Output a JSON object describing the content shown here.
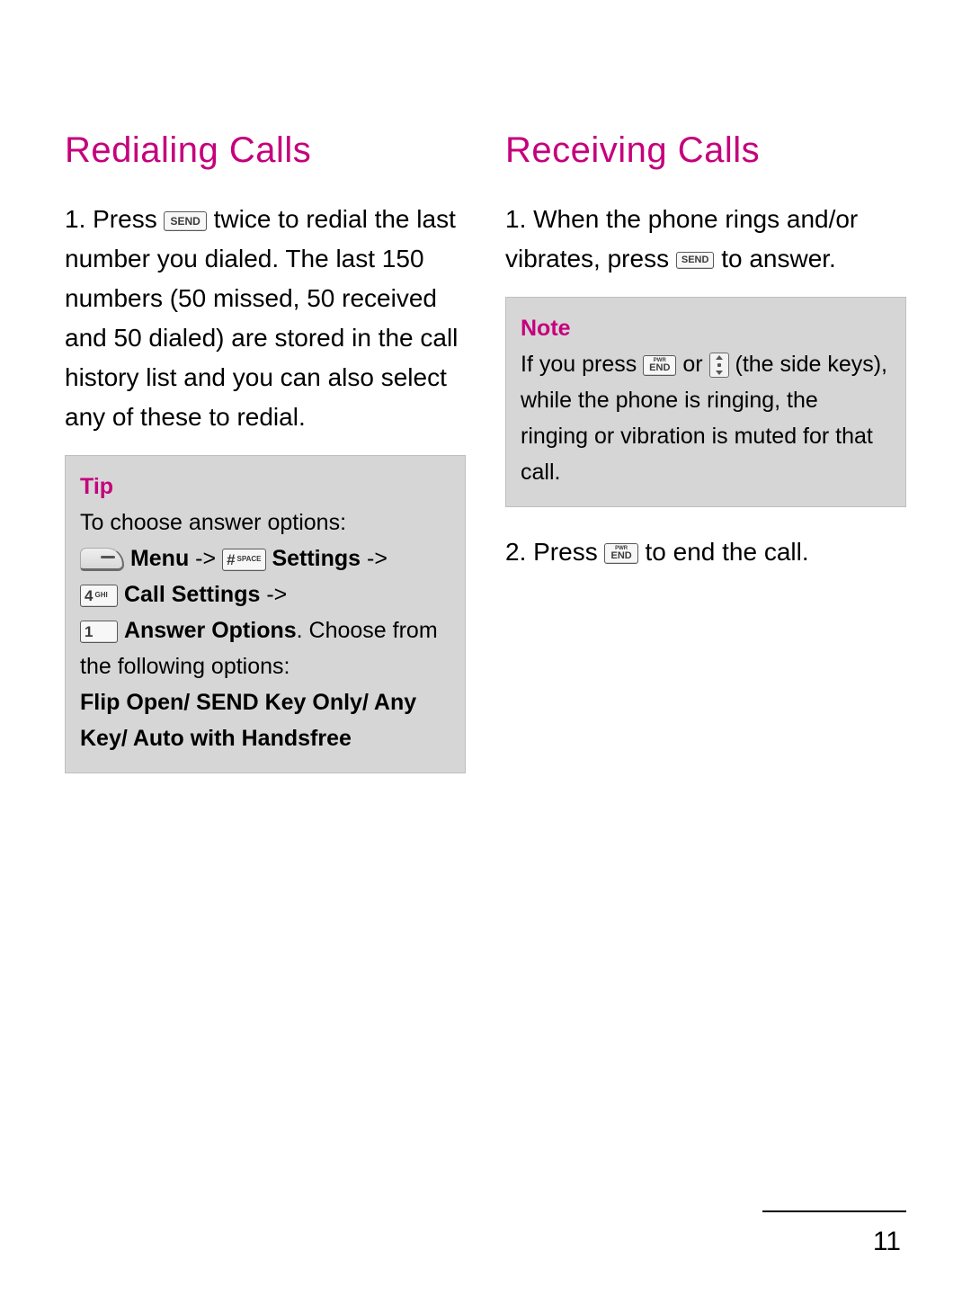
{
  "page_number": "11",
  "left": {
    "heading": "Redialing Calls",
    "step1_a": "1. Press ",
    "step1_b": " twice to redial the last number you dialed. The last 150 numbers (50 missed, 50 received and 50 dialed) are stored in the call history list and you can also select any of these to redial.",
    "tip": {
      "label": "Tip",
      "intro": "To choose answer options:",
      "menu": "Menu",
      "arrow": " -> ",
      "settings": "Settings",
      "call_settings": "Call Settings",
      "answer_options": "Answer Options",
      "tail": ". Choose from the following options:",
      "options_line": "Flip Open/ SEND Key Only/ Any Key/ Auto with Handsfree"
    }
  },
  "right": {
    "heading": "Receiving Calls",
    "step1_a": "1. When the phone rings and/or vibrates, press ",
    "step1_b": " to answer.",
    "note": {
      "label": "Note",
      "a": "If you press ",
      "or": " or ",
      "b": " (the side keys), while the phone is ringing, the ringing or vibration is muted for that call."
    },
    "step2_a": "2. Press ",
    "step2_b": " to end the call."
  },
  "keys": {
    "send": "SEND",
    "pwr": "PWR",
    "end": "END",
    "hash_main": "#",
    "hash_sub": "SPACE",
    "four": "4",
    "four_sub": "GHI",
    "one": "1"
  }
}
